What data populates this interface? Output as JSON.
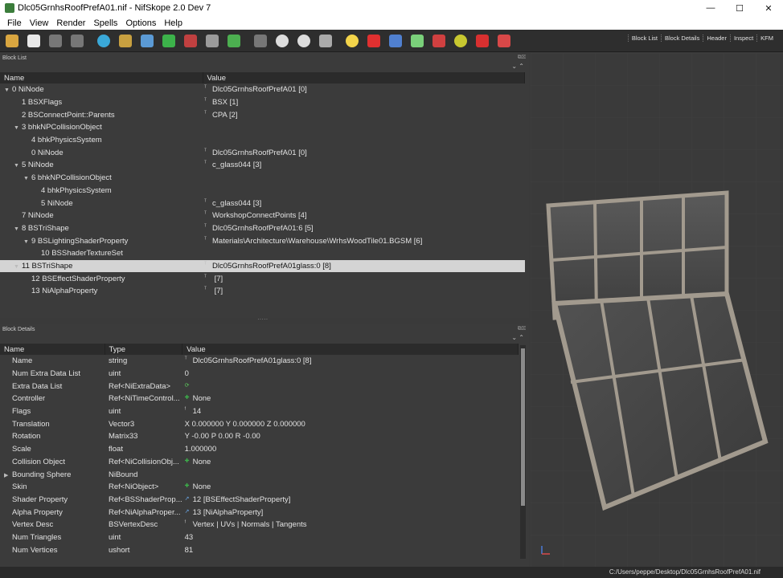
{
  "window": {
    "title": "Dlc05GrnhsRoofPrefA01.nif - NifSkope 2.0 Dev 7",
    "minimize": "—",
    "maximize": "☐",
    "close": "✕"
  },
  "menu": [
    "File",
    "View",
    "Render",
    "Spells",
    "Options",
    "Help"
  ],
  "toolbar_tabs": [
    "Block List",
    "Block Details",
    "Header",
    "Inspect",
    "KFM"
  ],
  "toolbar_icons": [
    {
      "name": "folder-icon",
      "color": "#d9a640"
    },
    {
      "name": "save-icon",
      "color": "#e8e8e8"
    },
    {
      "name": "hand-icon",
      "color": "#777777"
    },
    {
      "name": "node-select-icon",
      "color": "#777777"
    },
    {
      "name": "globe-icon",
      "color": "#3aa8d8"
    },
    {
      "name": "select-node-icon",
      "color": "#c8a040"
    },
    {
      "name": "cube-blue-icon",
      "color": "#5b9ad5"
    },
    {
      "name": "cube-green-icon",
      "color": "#3cb24a"
    },
    {
      "name": "cube-red-icon",
      "color": "#c04040"
    },
    {
      "name": "flip-icon",
      "color": "#9a9a9a"
    },
    {
      "name": "cube-rgb-icon",
      "color": "#4caf50"
    },
    {
      "name": "footsteps-icon",
      "color": "#777777"
    },
    {
      "name": "eye-icon",
      "color": "#dddddd"
    },
    {
      "name": "eye-dot-icon",
      "color": "#dddddd"
    },
    {
      "name": "screenshot-icon",
      "color": "#aaaaaa"
    },
    {
      "name": "lightbulb-icon",
      "color": "#f3d44a"
    },
    {
      "name": "pin-icon",
      "color": "#e03030"
    },
    {
      "name": "axes-icon",
      "color": "#5080d0"
    },
    {
      "name": "skeleton-icon",
      "color": "#7ad07a"
    },
    {
      "name": "magnet-icon",
      "color": "#d04040"
    },
    {
      "name": "sun-icon",
      "color": "#c8c830"
    },
    {
      "name": "marker-icon",
      "color": "#d83030"
    },
    {
      "name": "eraser-icon",
      "color": "#d84848"
    }
  ],
  "block_list": {
    "dock_title": "Block List",
    "columns": [
      "Name",
      "Value"
    ],
    "rows": [
      {
        "indent": 0,
        "expander": "▼",
        "name": "0 NiNode",
        "mark": "txt",
        "value": "Dlc05GrnhsRoofPrefA01 [0]"
      },
      {
        "indent": 1,
        "expander": "",
        "name": "1 BSXFlags",
        "mark": "txt",
        "value": "BSX [1]"
      },
      {
        "indent": 1,
        "expander": "",
        "name": "2 BSConnectPoint::Parents",
        "mark": "txt",
        "value": "CPA [2]"
      },
      {
        "indent": 1,
        "expander": "▼",
        "name": "3 bhkNPCollisionObject",
        "mark": "",
        "value": ""
      },
      {
        "indent": 2,
        "expander": "",
        "name": "4 bhkPhysicsSystem",
        "mark": "",
        "value": ""
      },
      {
        "indent": 2,
        "expander": "",
        "name": "0 NiNode",
        "mark": "txt",
        "value": "Dlc05GrnhsRoofPrefA01 [0]"
      },
      {
        "indent": 1,
        "expander": "▼",
        "name": "5 NiNode",
        "mark": "txt",
        "value": "c_glass044 [3]"
      },
      {
        "indent": 2,
        "expander": "▼",
        "name": "6 bhkNPCollisionObject",
        "mark": "",
        "value": ""
      },
      {
        "indent": 3,
        "expander": "",
        "name": "4 bhkPhysicsSystem",
        "mark": "",
        "value": ""
      },
      {
        "indent": 3,
        "expander": "",
        "name": "5 NiNode",
        "mark": "txt",
        "value": "c_glass044 [3]"
      },
      {
        "indent": 1,
        "expander": "",
        "name": "7 NiNode",
        "mark": "txt",
        "value": "WorkshopConnectPoints [4]"
      },
      {
        "indent": 1,
        "expander": "▼",
        "name": "8 BSTriShape",
        "mark": "txt",
        "value": "Dlc05GrnhsRoofPrefA01:6 [5]"
      },
      {
        "indent": 2,
        "expander": "▼",
        "name": "9 BSLightingShaderProperty",
        "mark": "txt",
        "value": "Materials\\Architecture\\Warehouse\\WrhsWoodTile01.BGSM [6]"
      },
      {
        "indent": 3,
        "expander": "",
        "name": "10 BSShaderTextureSet",
        "mark": "",
        "value": ""
      },
      {
        "indent": 1,
        "expander": "▼",
        "name": "11 BSTriShape",
        "mark": "txt",
        "value": "Dlc05GrnhsRoofPrefA01glass:0 [8]",
        "selected": true
      },
      {
        "indent": 2,
        "expander": "",
        "name": "12 BSEffectShaderProperty",
        "mark": "txt",
        "value": " [7]"
      },
      {
        "indent": 2,
        "expander": "",
        "name": "13 NiAlphaProperty",
        "mark": "txt",
        "value": " [7]"
      }
    ]
  },
  "block_details": {
    "dock_title": "Block Details",
    "columns": [
      "Name",
      "Type",
      "Value"
    ],
    "rows": [
      {
        "expander": "",
        "name": "Name",
        "type": "string",
        "mark": "txt",
        "value": "Dlc05GrnhsRoofPrefA01glass:0 [8]"
      },
      {
        "expander": "",
        "name": "Num Extra Data List",
        "type": "uint",
        "mark": "",
        "value": "0"
      },
      {
        "expander": "",
        "name": "Extra Data List",
        "type": "Ref<NiExtraData>",
        "mark": "refresh",
        "value": ""
      },
      {
        "expander": "",
        "name": "Controller",
        "type": "Ref<NiTimeControl...",
        "mark": "plus",
        "value": "None"
      },
      {
        "expander": "",
        "name": "Flags",
        "type": "uint",
        "mark": "flag",
        "value": "14"
      },
      {
        "expander": "",
        "name": "Translation",
        "type": "Vector3",
        "mark": "",
        "value": "X 0.000000 Y 0.000000 Z 0.000000"
      },
      {
        "expander": "",
        "name": "Rotation",
        "type": "Matrix33",
        "mark": "",
        "value": "Y -0.00 P 0.00 R -0.00"
      },
      {
        "expander": "",
        "name": "Scale",
        "type": "float",
        "mark": "",
        "value": "1.000000"
      },
      {
        "expander": "",
        "name": "Collision Object",
        "type": "Ref<NiCollisionObj...",
        "mark": "plus",
        "value": "None"
      },
      {
        "expander": "▶",
        "name": "Bounding Sphere",
        "type": "NiBound",
        "mark": "",
        "value": ""
      },
      {
        "expander": "",
        "name": "Skin",
        "type": "Ref<NiObject>",
        "mark": "plus",
        "value": "None"
      },
      {
        "expander": "",
        "name": "Shader Property",
        "type": "Ref<BSShaderProp...",
        "mark": "link",
        "value": "12 [BSEffectShaderProperty]"
      },
      {
        "expander": "",
        "name": "Alpha Property",
        "type": "Ref<NiAlphaProper...",
        "mark": "link",
        "value": "13 [NiAlphaProperty]"
      },
      {
        "expander": "",
        "name": "Vertex Desc",
        "type": "BSVertexDesc",
        "mark": "flag",
        "value": "Vertex | UVs | Normals | Tangents"
      },
      {
        "expander": "",
        "name": "Num Triangles",
        "type": "uint",
        "mark": "",
        "value": "43"
      },
      {
        "expander": "",
        "name": "Num Vertices",
        "type": "ushort",
        "mark": "",
        "value": "81"
      }
    ]
  },
  "status": {
    "path": "C:/Users/peppe/Desktop/Dlc05GrnhsRoofPrefA01.nif"
  }
}
